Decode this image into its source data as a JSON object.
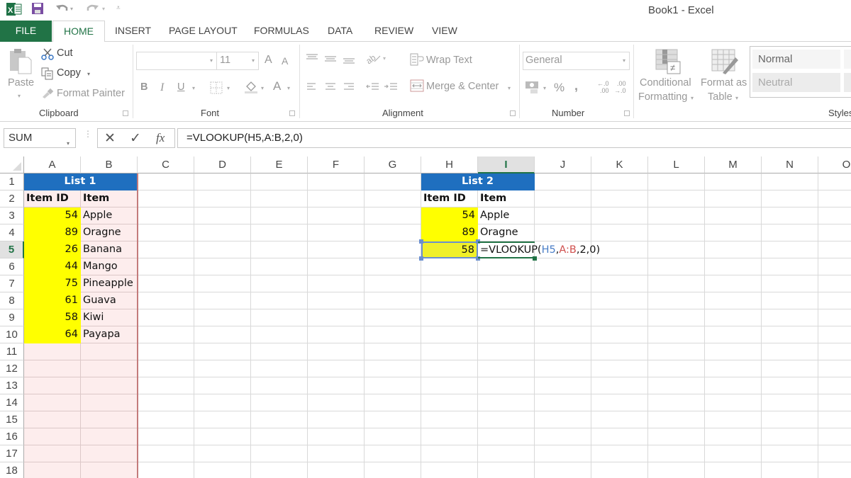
{
  "app": {
    "title": "Book1 - Excel",
    "accent_color": "#217346",
    "quick_access": {
      "excel_icon": "excel-logo-icon",
      "save_icon": "save-icon",
      "undo_icon": "undo-icon",
      "redo_icon": "redo-icon",
      "customize_icon": "customize-qat-icon"
    }
  },
  "tabs": [
    {
      "label": "FILE"
    },
    {
      "label": "HOME",
      "active": true
    },
    {
      "label": "INSERT"
    },
    {
      "label": "PAGE LAYOUT"
    },
    {
      "label": "FORMULAS"
    },
    {
      "label": "DATA"
    },
    {
      "label": "REVIEW"
    },
    {
      "label": "VIEW"
    }
  ],
  "ribbon": {
    "clipboard": {
      "label": "Clipboard",
      "paste": "Paste",
      "cut": "Cut",
      "copy": "Copy",
      "format_painter": "Format Painter"
    },
    "font": {
      "label": "Font",
      "font_name": "",
      "font_size": "11",
      "bold": "B",
      "italic": "I",
      "underline": "U",
      "grow": "A",
      "shrink": "A",
      "font_color": "A"
    },
    "alignment": {
      "label": "Alignment",
      "wrap_text": "Wrap Text",
      "merge_center": "Merge & Center"
    },
    "number": {
      "label": "Number",
      "format": "General",
      "percent": "%",
      "comma": ",",
      "inc_decimal_top": "←.0",
      "inc_decimal_bottom": ".00",
      "dec_decimal_top": ".00",
      "dec_decimal_bottom": "→.0"
    },
    "styles": {
      "label": "Styles",
      "conditional_formatting_1": "Conditional",
      "conditional_formatting_2": "Formatting",
      "format_as_table_1": "Format as",
      "format_as_table_2": "Table",
      "normal": "Normal",
      "neutral": "Neutral"
    }
  },
  "formula_bar": {
    "name_box": "SUM",
    "cancel_icon": "✕",
    "enter_icon": "✓",
    "fx_label": "fx",
    "formula": "=VLOOKUP(H5,A:B,2,0)"
  },
  "sheet": {
    "columns": [
      "A",
      "B",
      "C",
      "D",
      "E",
      "F",
      "G",
      "H",
      "I",
      "J",
      "K",
      "L",
      "M",
      "N",
      "O"
    ],
    "rows": [
      "1",
      "2",
      "3",
      "4",
      "5",
      "6",
      "7",
      "8",
      "9",
      "10",
      "11",
      "12",
      "13",
      "14",
      "15",
      "16",
      "17",
      "18"
    ],
    "selected_column": "I",
    "selected_row": "5",
    "list1": {
      "title": "List 1",
      "header_id": "Item ID",
      "header_item": "Item",
      "rows": [
        {
          "id": "54",
          "item": "Apple"
        },
        {
          "id": "89",
          "item": "Oragne"
        },
        {
          "id": "26",
          "item": "Banana"
        },
        {
          "id": "44",
          "item": "Mango"
        },
        {
          "id": "75",
          "item": "Pineapple"
        },
        {
          "id": "61",
          "item": "Guava"
        },
        {
          "id": "58",
          "item": "Kiwi"
        },
        {
          "id": "64",
          "item": "Payapa"
        }
      ]
    },
    "list2": {
      "title": "List 2",
      "header_id": "Item ID",
      "header_item": "Item",
      "rows": [
        {
          "id": "54",
          "item": "Apple"
        },
        {
          "id": "89",
          "item": "Oragne"
        }
      ],
      "edit_row": {
        "id": "58",
        "formula_prefix": "=VLOOKUP(",
        "ref1": "H5",
        "sep1": ",",
        "ref2": "A:B",
        "suffix": ",2,0)"
      }
    },
    "colors": {
      "header_fill": "#1f6fbf",
      "id_fill": "#ffff00",
      "range_fill": "#fdeded",
      "ref1_color": "#4a7ec7",
      "ref2_color": "#d0504e"
    }
  }
}
